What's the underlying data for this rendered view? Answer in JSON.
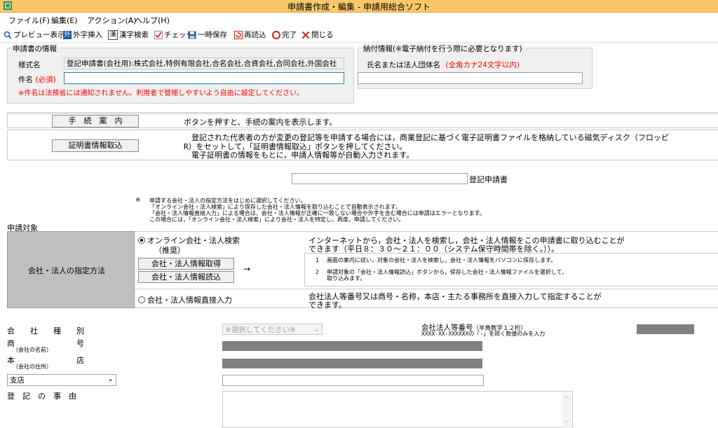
{
  "window": {
    "title": "申請書作成・編集 - 申請用総合ソフト"
  },
  "menu": [
    "ファイル(F)",
    "編集(E)",
    "アクション(A)",
    "ヘルプ(H)"
  ],
  "toolbar": [
    {
      "label": "プレビュー表示",
      "icon": "preview-icon"
    },
    {
      "label": "外字挿入",
      "icon": "gaiji-icon"
    },
    {
      "label": "漢字検索",
      "icon": "kanji-search-icon"
    },
    {
      "label": "チェック",
      "icon": "check-icon"
    },
    {
      "label": "一時保存",
      "icon": "save-icon"
    },
    {
      "label": "再読込",
      "icon": "reload-icon"
    },
    {
      "label": "完了",
      "icon": "complete-icon"
    },
    {
      "label": "閉じる",
      "icon": "close-icon"
    }
  ],
  "app_info": {
    "legend": "申請書の情報",
    "form_name_label": "様式名",
    "form_name_value": "登記申請書(会社用):株式会社,特例有限会社,合名会社,合資会社,合同会社,外国会社",
    "subject_label": "件名",
    "required": "(必須)",
    "subject_value": "",
    "note": "※件名は法務省には通知されません。利用者で管理しやすいよう自由に設定してください。"
  },
  "payment": {
    "legend": "納付情報(※電子納付を行う際に必要となります)",
    "name_label": "氏名または法人団体名",
    "name_hint": "(全角カナ24文字以内)",
    "name_value": ""
  },
  "guide": {
    "button": "手　続　案　内",
    "text": "ボタンを押すと、手続の案内を表示します。"
  },
  "cert": {
    "button": "証明書情報取込",
    "text1": "登記された代表者の方が変更の登記等を申請する場合には，商業登記に基づく電子証明書ファイルを格納している磁気ディスク（フロッピ",
    "text2": "R）をセットして，「証明書情報取込」ボタンを押してください。",
    "text3": "電子証明書の情報をもとに，申請人情報等が自動入力されます。"
  },
  "form_title": {
    "value": "",
    "label": "登記申請書"
  },
  "notice": {
    "mark": "※",
    "lines": [
      "申請する会社・法人の指定方法をはじめに選択してください。",
      "「オンライン会社・法人検索」により保存した会社・法人情報を取り込むことで自動表示されます。",
      "「会社・法人情報直接入力」による場合は，会社・法人情報が正確に一致しない場合や外字を含む場合には申請はエラーとなります。",
      "この場合には，「オンライン会社・法人検索」により会社・法人を特定し，再度，申請してください。"
    ]
  },
  "target_label": "申請対象",
  "method": {
    "label": "会社・法人の指定方法",
    "online_label": "オンライン会社・法人検索",
    "online_sub": "（推奨）",
    "fetch_button": "会社・法人情報取得",
    "load_button": "会社・法人情報読込",
    "arrow": "→",
    "online_desc1": "インターネットから，会社・法人を検索し，会社・法人情報をこの申請書に取り込むことが",
    "online_desc2": "できます（平日８：３０～２１：００（システム保守時間帯を除く。））。",
    "step1_no": "1",
    "step1": "画面の案内に従い，対象の会社・法人を検索し，会社・法人情報をパソコンに保存します。",
    "step2_no": "2",
    "step2a": "申請対象の「会社・法人情報読込」ボタンから，保存した会社・法人情報ファイルを選択して，",
    "step2b": "取り込みます。",
    "direct_label": "会社・法人情報直接入力",
    "direct_desc1": "会社法人等番号又は商号・名称，本店・主たる事務所を直接入力して指定することが",
    "direct_desc2": "できます。",
    "selected": "online"
  },
  "fields": {
    "company_type_label": "会　　社　　種　　別",
    "company_type_select": "※選択してください※",
    "corp_number_label": "会社法人等番号",
    "corp_number_hint": "（半角数字１２桁）",
    "corp_number_format": "XXXX-XX-XXXXXXの「-」を除く数値のみを入力",
    "trade_name_label": "商　　　　　　　　号",
    "trade_name_sub": "（会社の名前）",
    "head_office_label": "本　　　　　　　　店",
    "head_office_sub": "（会社の住所）",
    "branch_select": "支店",
    "branch_value": "",
    "reason_label": "登　記　の　事　由",
    "reason_value": ""
  }
}
